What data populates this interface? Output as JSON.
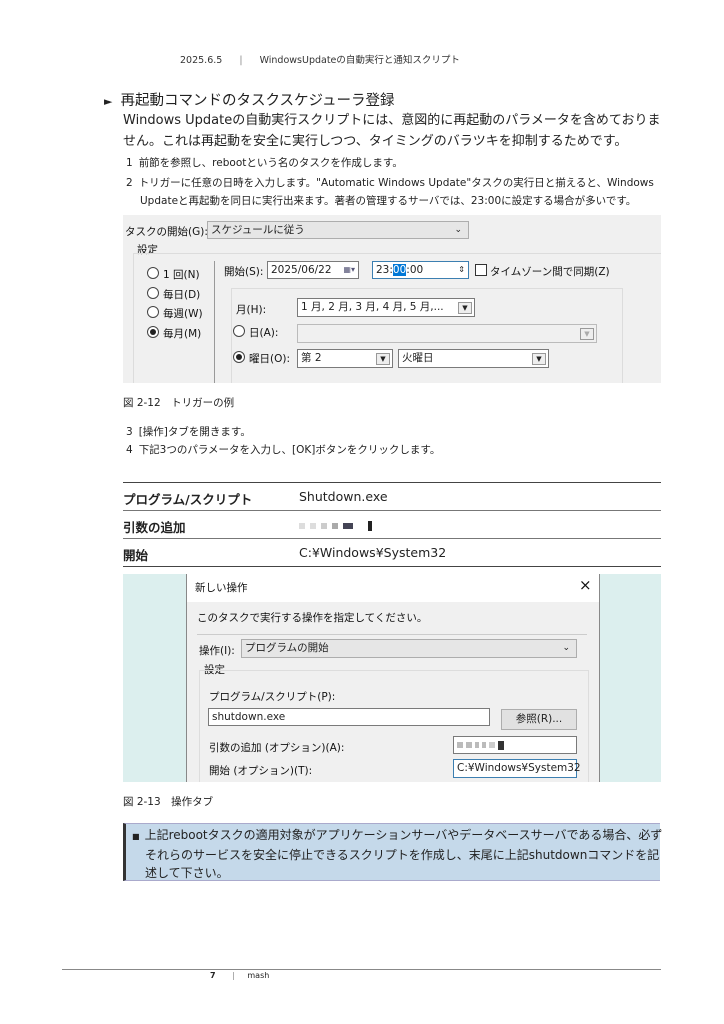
{
  "header": {
    "date": "2025.6.5",
    "separator": "|",
    "title": "WindowsUpdateの自動実行と通知スクリプト"
  },
  "section": {
    "bullet": "►",
    "heading": "再起動コマンドのタスクスケジューラ登録",
    "paragraph": "Windows Updateの自動実行スクリプトには、意図的に再起動のパラメータを含めておりません。これは再起動を安全に実行しつつ、タイミングのバラツキを抑制するためです。"
  },
  "steps": [
    {
      "num": "1",
      "text": "前節を参照し、rebootという名のタスクを作成します。"
    },
    {
      "num": "2",
      "text": "トリガーに任意の日時を入力します。\"Automatic Windows Update\"タスクの実行日と揃えると、Windows Updateと再起動を同日に実行出来ます。著者の管理するサーバでは、23:00に設定する場合が多いです。"
    },
    {
      "num": "3",
      "text": "[操作]タブを開きます。"
    },
    {
      "num": "4",
      "text": "下記3つのパラメータを入力し、[OK]ボタンをクリックします。"
    }
  ],
  "trigger": {
    "task_start_label": "タスクの開始(G):",
    "task_start_value": "スケジュールに従う",
    "settings_label": "設定",
    "radios": [
      {
        "label": "1 回(N)",
        "checked": false
      },
      {
        "label": "毎日(D)",
        "checked": false
      },
      {
        "label": "毎週(W)",
        "checked": false
      },
      {
        "label": "毎月(M)",
        "checked": true
      }
    ],
    "start_label": "開始(S):",
    "start_date": "2025/06/22",
    "start_time_h": "23:",
    "start_time_m": "00",
    "start_time_s": ":00",
    "timezone_label": "タイムゾーン間で同期(Z)",
    "month_label": "月(H):",
    "month_value": "1 月, 2 月, 3 月, 4 月, 5 月,...",
    "day_label": "日(A):",
    "weekday_label": "曜日(O):",
    "week_value": "第 2",
    "weekday_value": "火曜日"
  },
  "caption1": "図 2-12　トリガーの例",
  "table": [
    {
      "label": "プログラム/スクリプト",
      "value": "Shutdown.exe"
    },
    {
      "label": "引数の追加",
      "value": ""
    },
    {
      "label": "開始",
      "value": "C:¥Windows¥System32"
    }
  ],
  "dialog": {
    "title": "新しい操作",
    "close": "×",
    "instruction": "このタスクで実行する操作を指定してください。",
    "action_label": "操作(I):",
    "action_value": "プログラムの開始",
    "settings_label": "設定",
    "program_label": "プログラム/スクリプト(P):",
    "program_value": "shutdown.exe",
    "browse_label": "参照(R)...",
    "args_label": "引数の追加 (オプション)(A):",
    "start_label": "開始 (オプション)(T):",
    "start_value": "C:¥Windows¥System32"
  },
  "caption2": "図 2-13　操作タブ",
  "note": {
    "bullet": "■",
    "text": "上記rebootタスクの適用対象がアプリケーションサーバやデータベースサーバである場合、必ずそれらのサービスを安全に停止できるスクリプトを作成し、末尾に上記shutdownコマンドを記述して下さい。"
  },
  "footer": {
    "page": "7",
    "separator": "|",
    "author": "mash"
  }
}
